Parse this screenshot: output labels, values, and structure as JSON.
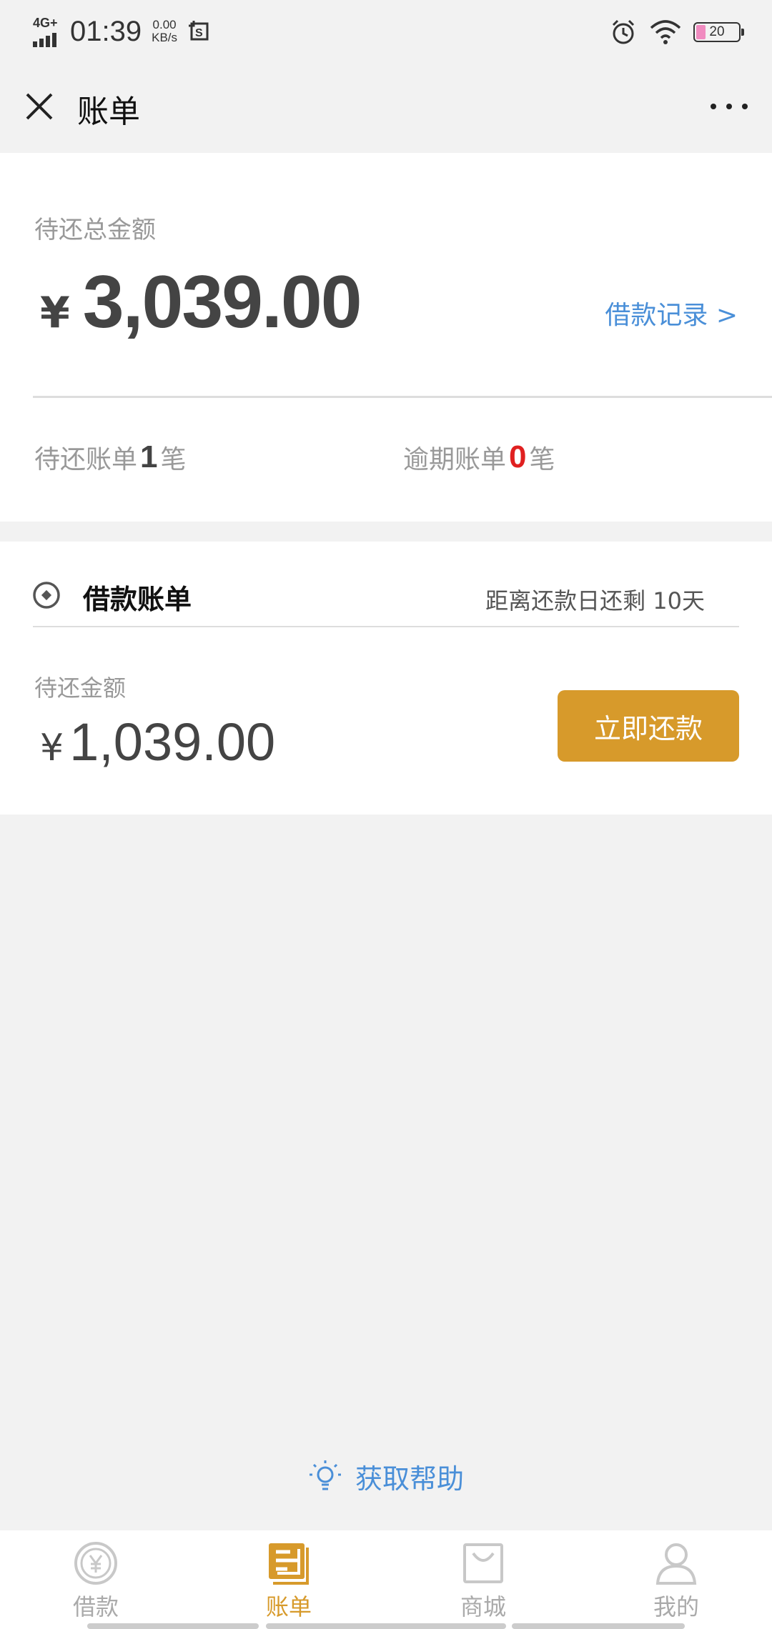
{
  "status_bar": {
    "network": "4G+",
    "time": "01:39",
    "speed_value": "0.00",
    "speed_unit": "KB/s",
    "battery": "20"
  },
  "header": {
    "title": "账单"
  },
  "summary": {
    "label": "待还总金额",
    "currency": "¥",
    "amount": "3,039.00",
    "loan_record_link": "借款记录 >",
    "pending_prefix": "待还账单",
    "pending_count": "1",
    "pending_suffix": "笔",
    "overdue_prefix": "逾期账单",
    "overdue_count": "0",
    "overdue_suffix": "笔"
  },
  "bill": {
    "title": "借款账单",
    "due_text": "距离还款日还剩 10天",
    "label": "待还金额",
    "currency": "¥",
    "amount": "1,039.00",
    "pay_button": "立即还款"
  },
  "help": {
    "label": "获取帮助"
  },
  "tabs": [
    {
      "label": "借款",
      "icon": "yen-circle-icon",
      "active": false
    },
    {
      "label": "账单",
      "icon": "bill-icon",
      "active": true
    },
    {
      "label": "商城",
      "icon": "shopping-bag-icon",
      "active": false
    },
    {
      "label": "我的",
      "icon": "person-icon",
      "active": false
    }
  ],
  "colors": {
    "accent": "#d79a2b",
    "link": "#4a8fd8",
    "overdue": "#e02020",
    "background": "#f2f2f2"
  }
}
